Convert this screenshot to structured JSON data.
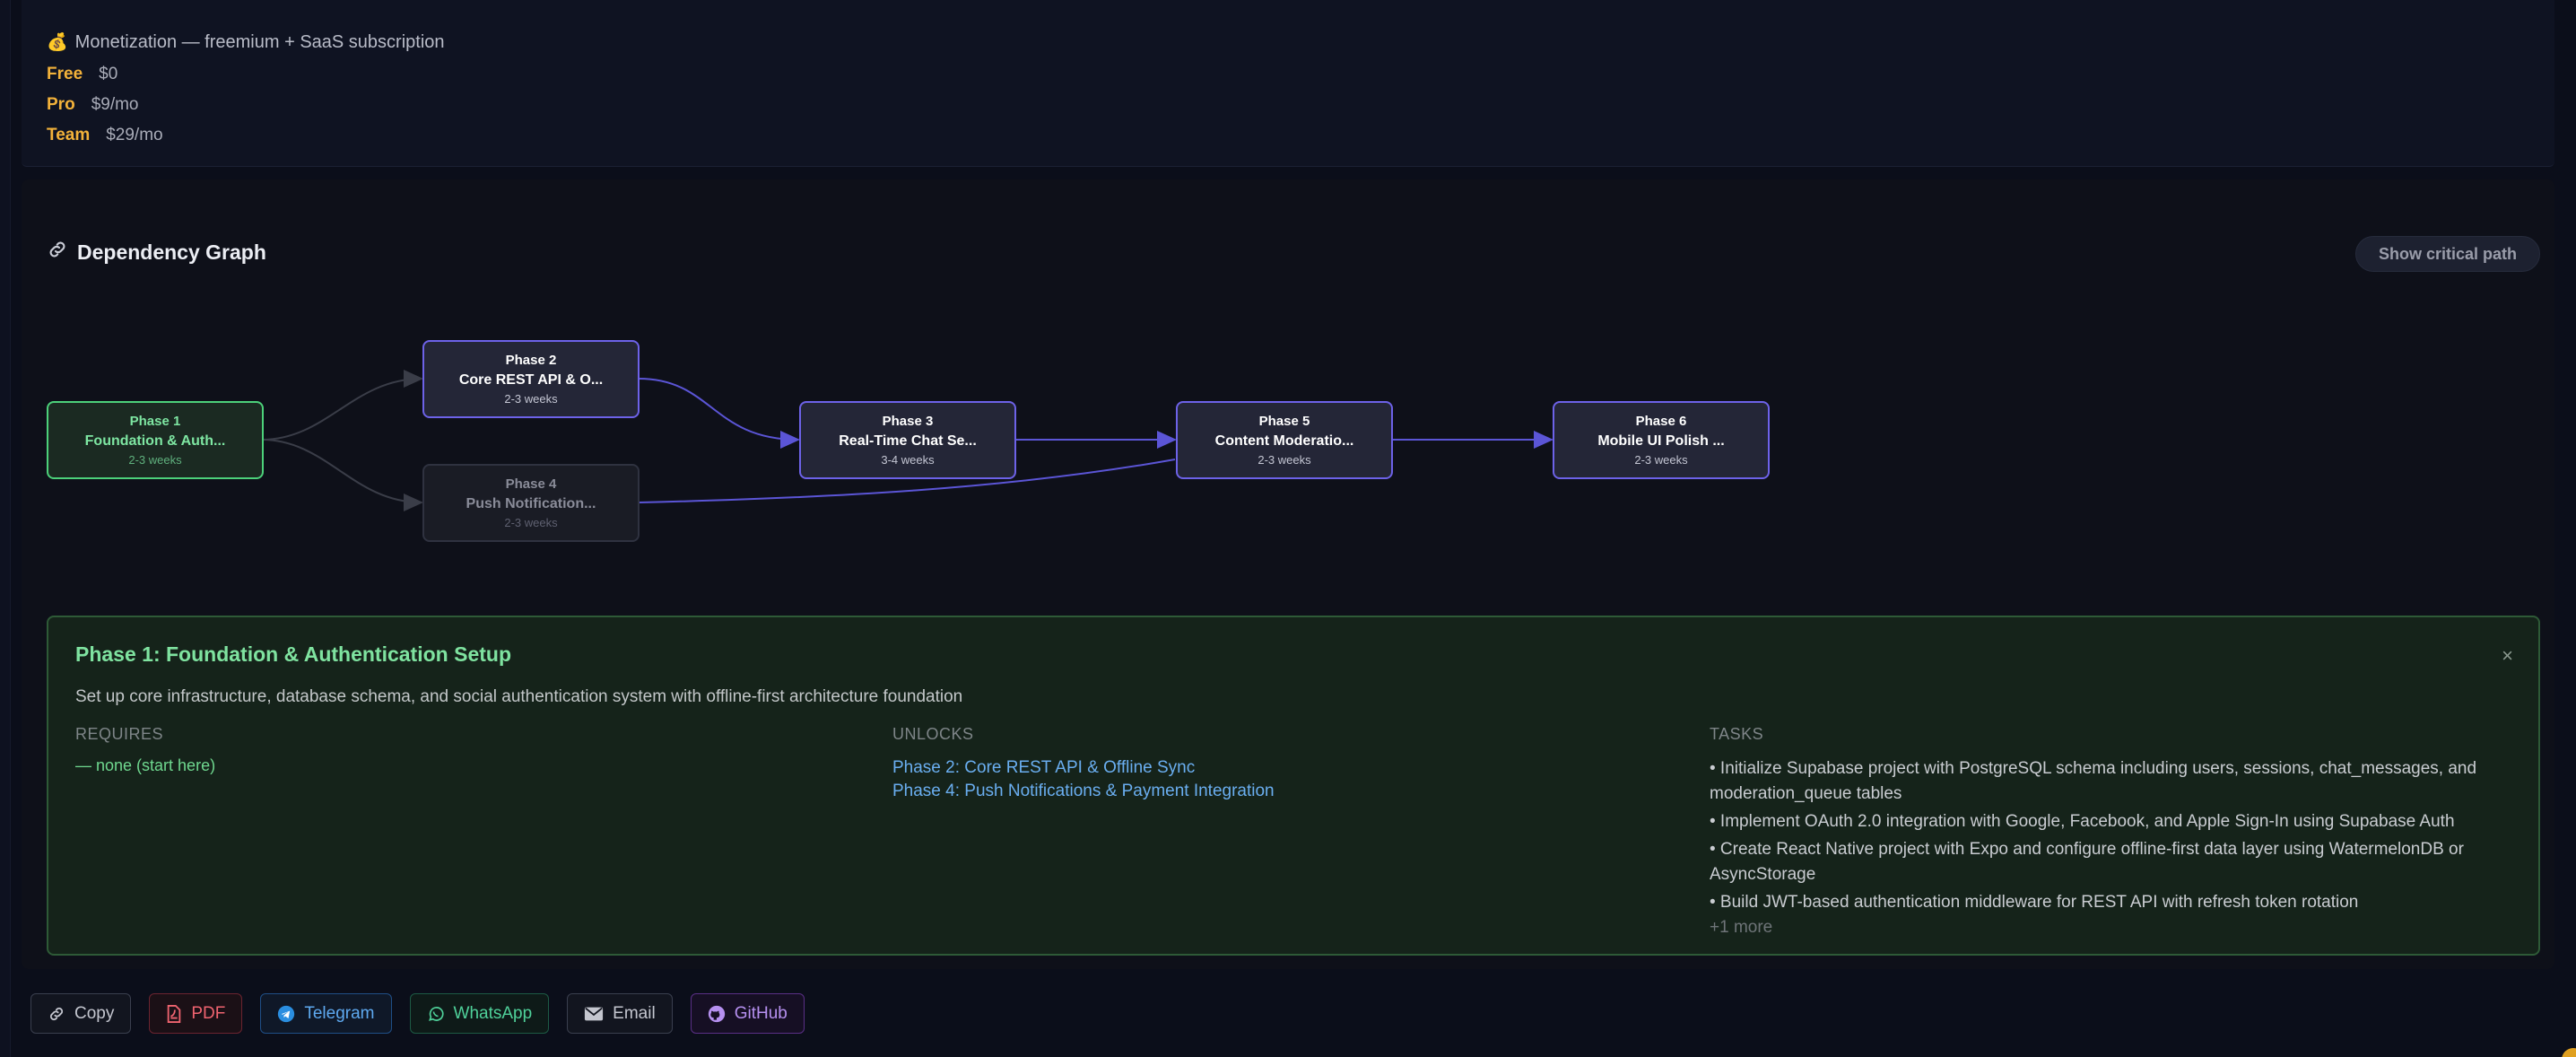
{
  "monetization": {
    "icon": "money-bag-icon",
    "emoji": "💰",
    "title": "Monetization — freemium + SaaS subscription",
    "tiers": [
      {
        "name": "Free",
        "price": "$0"
      },
      {
        "name": "Pro",
        "price": "$9/mo"
      },
      {
        "name": "Team",
        "price": "$29/mo"
      }
    ]
  },
  "graph": {
    "title": "Dependency Graph",
    "icon": "link-icon",
    "critical_path_label": "Show critical path",
    "nodes": [
      {
        "phase": "Phase 1",
        "name": "Foundation & Auth...",
        "weeks": "2-3 weeks",
        "state": "active"
      },
      {
        "phase": "Phase 2",
        "name": "Core REST API & O...",
        "weeks": "2-3 weeks",
        "state": "normal"
      },
      {
        "phase": "Phase 4",
        "name": "Push Notification...",
        "weeks": "2-3 weeks",
        "state": "dim"
      },
      {
        "phase": "Phase 3",
        "name": "Real-Time Chat Se...",
        "weeks": "3-4 weeks",
        "state": "normal"
      },
      {
        "phase": "Phase 5",
        "name": "Content Moderatio...",
        "weeks": "2-3 weeks",
        "state": "normal"
      },
      {
        "phase": "Phase 6",
        "name": "Mobile UI Polish ...",
        "weeks": "2-3 weeks",
        "state": "normal"
      }
    ],
    "edge_colors": {
      "active": "#5b55d6",
      "muted": "#3a3d48"
    }
  },
  "detail": {
    "title": "Phase 1: Foundation & Authentication Setup",
    "close": "×",
    "description": "Set up core infrastructure, database schema, and social authentication system with offline-first architecture foundation",
    "requires_label": "REQUIRES",
    "requires_value": "— none (start here)",
    "unlocks_label": "UNLOCKS",
    "unlocks": [
      "Phase 2: Core REST API & Offline Sync",
      "Phase 4: Push Notifications & Payment Integration"
    ],
    "tasks_label": "TASKS",
    "tasks": [
      "• Initialize Supabase project with PostgreSQL schema including users, sessions, chat_messages, and moderation_queue tables",
      "• Implement OAuth 2.0 integration with Google, Facebook, and Apple Sign-In using Supabase Auth",
      "• Create React Native project with Expo and configure offline-first data layer using WatermelonDB or AsyncStorage",
      "• Build JWT-based authentication middleware for REST API with refresh token rotation"
    ],
    "more": "+1 more"
  },
  "share": [
    {
      "label": "Copy",
      "icon": "link-icon",
      "key": "copy"
    },
    {
      "label": "PDF",
      "icon": "pdf-icon",
      "key": "pdf"
    },
    {
      "label": "Telegram",
      "icon": "telegram-icon",
      "key": "tg"
    },
    {
      "label": "WhatsApp",
      "icon": "whatsapp-icon",
      "key": "wa"
    },
    {
      "label": "Email",
      "icon": "email-icon",
      "key": "mail"
    },
    {
      "label": "GitHub",
      "icon": "github-icon",
      "key": "gh"
    }
  ]
}
